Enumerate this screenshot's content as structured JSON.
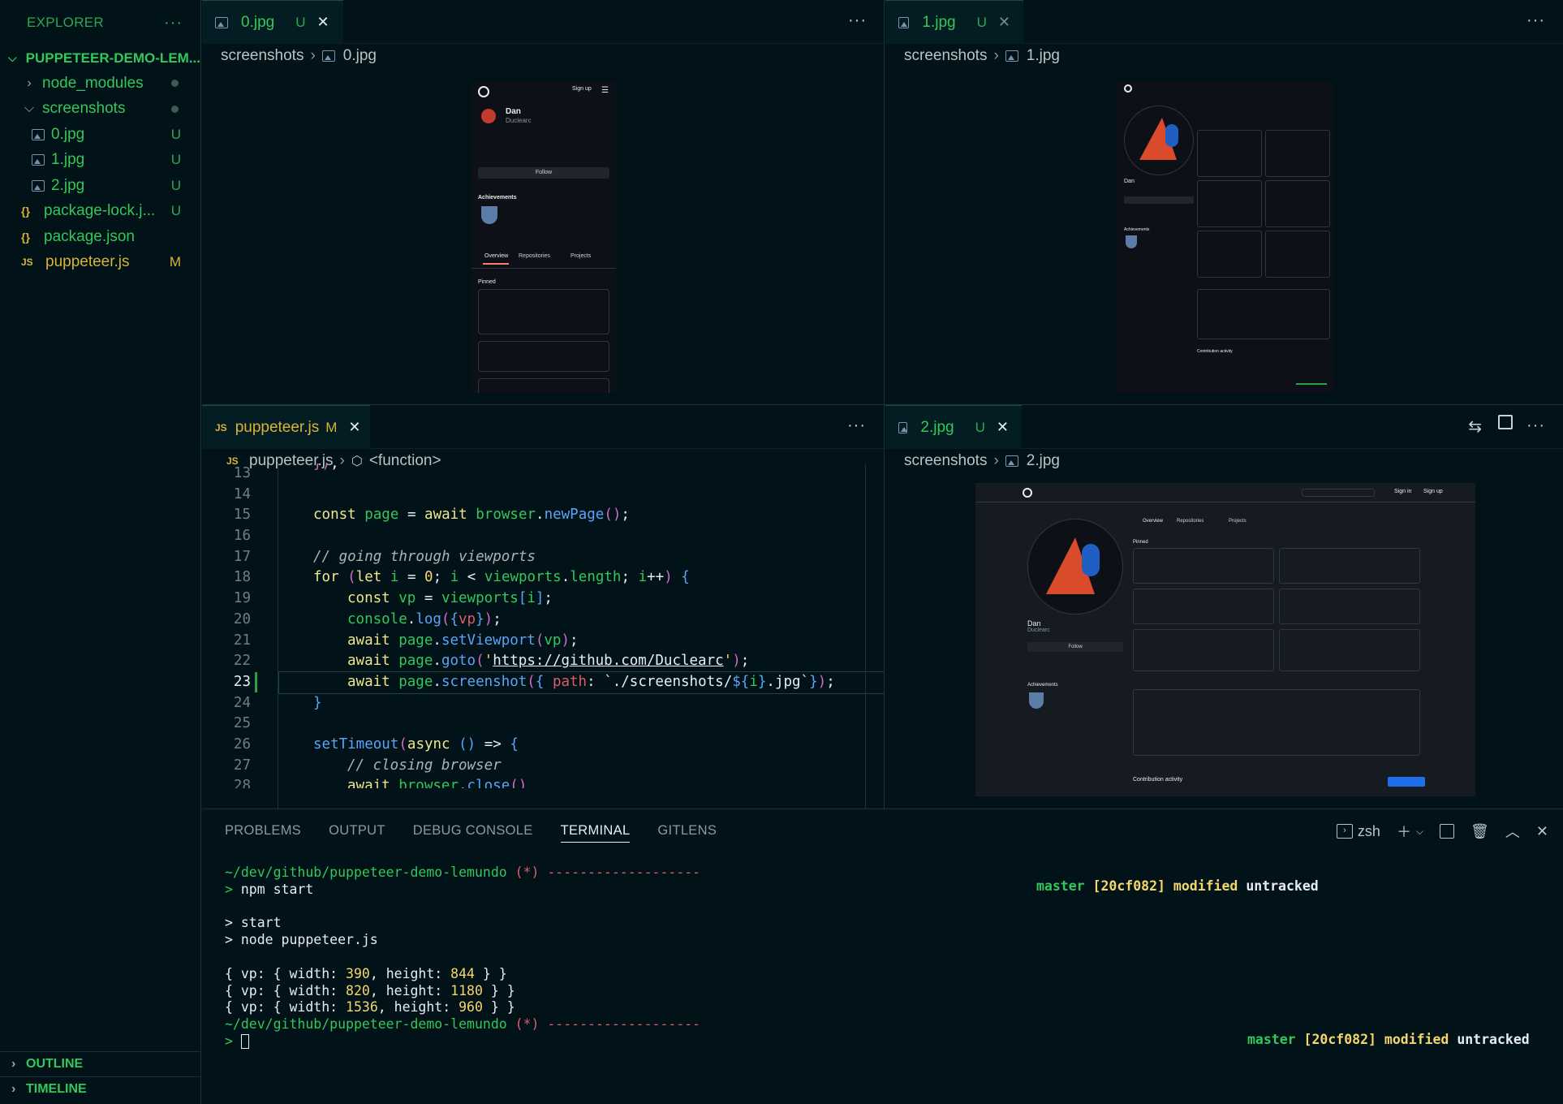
{
  "sidebar": {
    "title": "EXPLORER",
    "more": "···",
    "project": "PUPPETEER-DEMO-LEM...",
    "items": [
      {
        "label": "node_modules",
        "badge": ""
      },
      {
        "label": "screenshots",
        "badge": ""
      },
      {
        "label": "0.jpg",
        "badge": "U"
      },
      {
        "label": "1.jpg",
        "badge": "U"
      },
      {
        "label": "2.jpg",
        "badge": "U"
      },
      {
        "label": "package-lock.j...",
        "badge": "U"
      },
      {
        "label": "package.json",
        "badge": ""
      },
      {
        "label": "puppeteer.js",
        "badge": "M"
      }
    ],
    "outline": "OUTLINE",
    "timeline": "TIMELINE"
  },
  "panes": {
    "p0": {
      "tab": "0.jpg",
      "status": "U",
      "crumb_folder": "screenshots",
      "crumb_file": "0.jpg"
    },
    "p1": {
      "tab": "1.jpg",
      "status": "U",
      "crumb_folder": "screenshots",
      "crumb_file": "1.jpg"
    },
    "p2": {
      "tab": "puppeteer.js",
      "status": "M",
      "crumb_file": "puppeteer.js",
      "crumb_symbol": "<function>"
    },
    "p3": {
      "tab": "2.jpg",
      "status": "U",
      "crumb_folder": "screenshots",
      "crumb_file": "2.jpg"
    }
  },
  "code": {
    "current_line": 23,
    "lines": [
      {
        "n": "13",
        "t": "});"
      },
      {
        "n": "14",
        "t": ""
      },
      {
        "n": "15",
        "t": "const page = await browser.newPage();"
      },
      {
        "n": "16",
        "t": ""
      },
      {
        "n": "17",
        "t": "// going through viewports"
      },
      {
        "n": "18",
        "t": "for (let i = 0; i < viewports.length; i++) {"
      },
      {
        "n": "19",
        "t": "const vp = viewports[i];"
      },
      {
        "n": "20",
        "t": "console.log({vp});"
      },
      {
        "n": "21",
        "t": "await page.setViewport(vp);"
      },
      {
        "n": "22",
        "t": "await page.goto('https://github.com/Duclearc');"
      },
      {
        "n": "23",
        "t": "await page.screenshot({ path: `./screenshots/${i}.jpg`});"
      },
      {
        "n": "24",
        "t": "}"
      },
      {
        "n": "25",
        "t": ""
      },
      {
        "n": "26",
        "t": "setTimeout(async () => {"
      },
      {
        "n": "27",
        "t": "// closing browser"
      },
      {
        "n": "28",
        "t": "await browser.close()"
      }
    ]
  },
  "panel": {
    "tabs": [
      "PROBLEMS",
      "OUTPUT",
      "DEBUG CONSOLE",
      "TERMINAL",
      "GITLENS"
    ],
    "active_tab": "TERMINAL",
    "shell": "zsh"
  },
  "terminal": {
    "path": "~/dev/github/puppeteer-demo-lemundo",
    "marker": "(*)",
    "rule": "-------------------",
    "prompt": ">",
    "cmd": "npm start",
    "out1": "> start",
    "out2": "> node puppeteer.js",
    "vps": [
      {
        "w": "390",
        "h": "844"
      },
      {
        "w": "820",
        "h": "1180"
      },
      {
        "w": "1536",
        "h": "960"
      }
    ],
    "git_branch": "master",
    "git_hash": "[20cf082]",
    "git_mod": "modified",
    "git_untracked": "untracked"
  },
  "previews": {
    "user_name": "Dan",
    "user_handle": "Duclearc",
    "follow": "Follow",
    "achievements": "Achievements",
    "pinned": "Pinned",
    "nav_overview": "Overview",
    "nav_repos": "Repositories",
    "nav_projects": "Projects",
    "signup": "Sign up",
    "signin": "Sign in",
    "contrib": "Contribution activity"
  },
  "colors": {
    "accent": "#34c759",
    "bg": "#011218",
    "modified": "#d9b338"
  }
}
